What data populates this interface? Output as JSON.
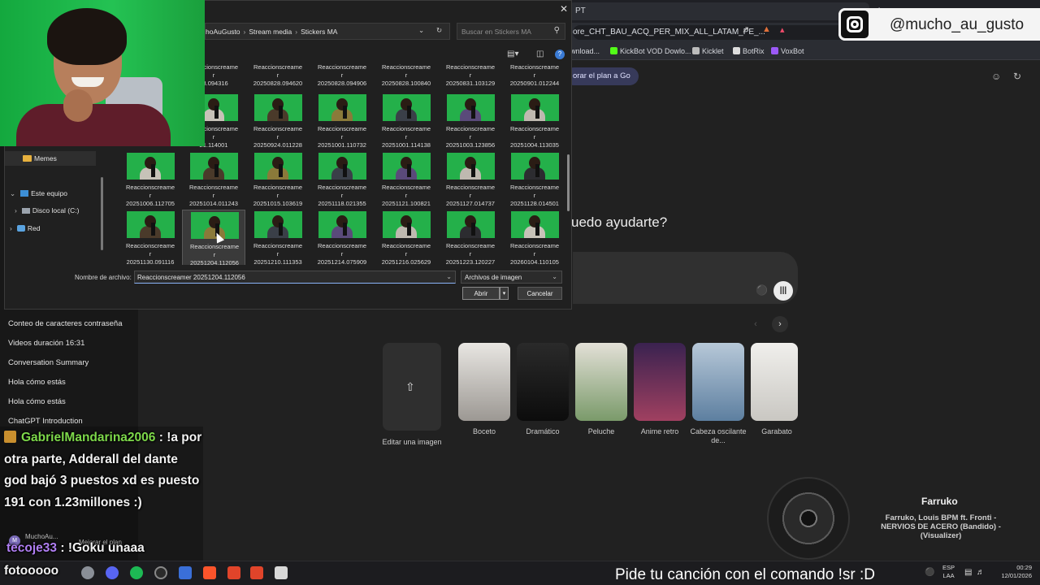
{
  "browser": {
    "tab_title": "PT",
    "tab_close": "×",
    "new_tab": "+",
    "url": "ore_CHT_BAU_ACQ_PER_MIX_ALL_LATAM_PE_...",
    "bookmarks": [
      {
        "label": "wnload...",
        "color": "#888888"
      },
      {
        "label": "KickBot VOD Dowlo...",
        "color": "#53fc18"
      },
      {
        "label": "Kicklet",
        "color": "#bbbbbb"
      },
      {
        "label": "BotRix",
        "color": "#dddddd"
      },
      {
        "label": "VoxBot",
        "color": "#9b59f6"
      }
    ]
  },
  "gpt": {
    "upgrade": "orar el plan a Go",
    "headline": "uedo ayudarte?",
    "sidebar_items": [
      "Conteo de caracteres contraseña",
      "Videos duración 16:31",
      "Conversation Summary",
      "Hola cómo estás",
      "Hola cómo estás",
      "ChatGPT Introduction"
    ],
    "edit_image": "Editar una imagen",
    "styles": [
      "Boceto",
      "Dramático",
      "Peluche",
      "Anime retro",
      "Cabeza oscilante de...",
      "Garabato"
    ],
    "user_name": "MuchoAu...",
    "upgrade_plan": "Mejorar el plan",
    "avatar_initial": "M"
  },
  "instagram": {
    "handle": "@mucho_au_gusto"
  },
  "dialog": {
    "breadcrumb": [
      "hoAuGusto",
      "Stream media",
      "Stickers MA"
    ],
    "search_placeholder": "Buscar en Stickers MA",
    "nav": {
      "memes": "Memes",
      "this_pc": "Este equipo",
      "local_disk": "Disco local (C:)",
      "network": "Red"
    },
    "file_prefix": "Reaccionscreame",
    "file_prefix_r": "r",
    "top_row": [
      "28.094316",
      "20250828.094620",
      "20250828.094906",
      "20250828.100840",
      "20250831.103129",
      "20250901.012244"
    ],
    "files": [
      [
        "21.114001",
        "20250924.011228",
        "20251001.110732",
        "20251001.114138",
        "20251003.123856",
        "20251004.113035"
      ],
      [
        "20251006.112705",
        "20251014.011243",
        "20251015.103619",
        "20251118.021355",
        "20251121.100821",
        "20251127.014737",
        "20251128.014501"
      ],
      [
        "20251130.091116",
        "20251204.112056",
        "20251210.111353",
        "20251214.075909",
        "20251216.025629",
        "20251223.120227",
        "20260104.110105"
      ]
    ],
    "filename_label": "Nombre de archivo:",
    "filename_value": "Reaccionscreamer 20251204.112056",
    "filetype": "Archivos de imagen",
    "open": "Abrir",
    "cancel": "Cancelar"
  },
  "chat": {
    "user1": "GabrielMandarina2006",
    "msg1": " : !a por otra parte, Adderall del dante god bajó 3 puestos xd es puesto 191 con 1.23millones :)",
    "user2": "tecoje33",
    "msg2": " : !Goku unaaa",
    "msg3": "fotooooo"
  },
  "music": {
    "title": "Farruko",
    "subtitle": "Farruko, Louis BPM ft. Fronti - NERVIOS DE ACERO (Bandido) - (Visualizer)"
  },
  "taskbar": {
    "song_request": "Pide tu canción con el comando !sr :D",
    "lang1": "ESP",
    "lang2": "LAA",
    "time": "00:29",
    "date": "12/01/2026"
  }
}
